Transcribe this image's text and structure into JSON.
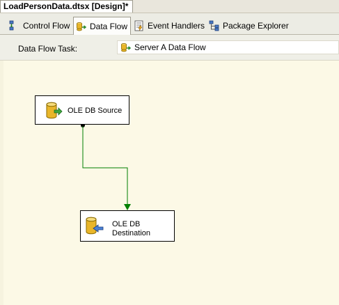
{
  "document": {
    "tab_title": "LoadPersonData.dtsx [Design]*"
  },
  "designer_tabs": [
    {
      "label": "Control Flow",
      "icon": "control-flow-icon",
      "active": false
    },
    {
      "label": "Data Flow",
      "icon": "data-flow-icon",
      "active": true
    },
    {
      "label": "Event Handlers",
      "icon": "event-handlers-icon",
      "active": false
    },
    {
      "label": "Package Explorer",
      "icon": "package-explorer-icon",
      "active": false
    }
  ],
  "task_selector": {
    "label": "Data Flow Task:",
    "value": "Server A Data Flow"
  },
  "canvas": {
    "components": [
      {
        "name": "OLE DB Source",
        "lines": [
          "OLE DB Source"
        ],
        "icon": "ole-db-source-icon"
      },
      {
        "name": "OLE DB Destination",
        "lines": [
          "OLE DB",
          "Destination"
        ],
        "icon": "ole-db-destination-icon"
      }
    ],
    "path_color": "#008000"
  },
  "colors": {
    "canvas": "#fcf9e6",
    "path": "#008000",
    "db_gold": "#e9b62a"
  }
}
